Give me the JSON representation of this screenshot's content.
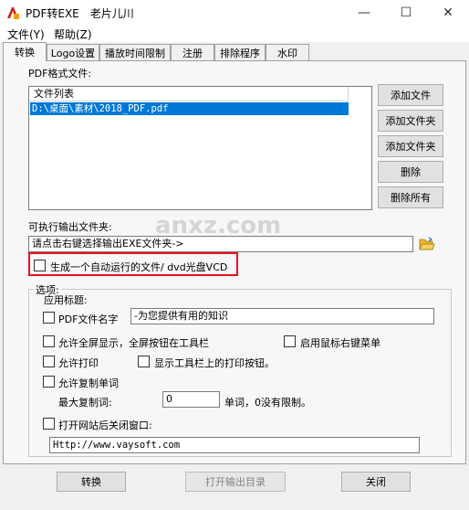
{
  "window": {
    "title": "PDF转EXE　老片儿川",
    "controls": {
      "minimize": "—",
      "maximize": "☐",
      "close": "✕"
    }
  },
  "menu": [
    "文件(Y)",
    "帮助(Z)"
  ],
  "tabs": [
    "转换",
    "Logo设置",
    "播放时间限制",
    "注册",
    "排除程序",
    "水印"
  ],
  "active_tab": "转换",
  "pdf_section": {
    "label": "PDF格式文件:",
    "list_header": "文件列表",
    "files": [
      "D:\\桌面\\素材\\2018_PDF.pdf"
    ],
    "buttons": [
      "添加文件",
      "添加文件夹",
      "添加文件夹",
      "删除",
      "删除所有"
    ]
  },
  "output_section": {
    "label": "可执行输出文件夹:",
    "placeholder": "请点击右键选择输出EXE文件夹->",
    "folder_icon": "folder-open-icon",
    "autorun_label": "生成一个自动运行的文件/ dvd光盘VCD",
    "autorun_checked": false
  },
  "options": {
    "group_label": "选项:",
    "app_title_label": "应用标题:",
    "pdf_name_label": "PDF文件名字",
    "pdf_name_value": "-为您提供有用的知识",
    "fullscreen_label": "允许全屏显示，全屏按钮在工具栏",
    "right_click_label": "启用鼠标右键菜单",
    "print_label": "允许打印",
    "show_print_button_label": "显示工具栏上的打印按钮。",
    "copy_words_label": "允许复制单词",
    "max_copy_label": "最大复制词:",
    "max_copy_value": "0",
    "max_copy_suffix": "单词，0没有限制。",
    "open_site_label": "打开网站后关闭窗口:",
    "site_url": "Http://www.vaysoft.com"
  },
  "bottom_buttons": {
    "convert": "转换",
    "open_output": "打开输出目录",
    "close": "关闭"
  },
  "watermark_text": "anxz.com",
  "colors": {
    "selection": "#0078d7",
    "highlight_box": "#e81123"
  }
}
